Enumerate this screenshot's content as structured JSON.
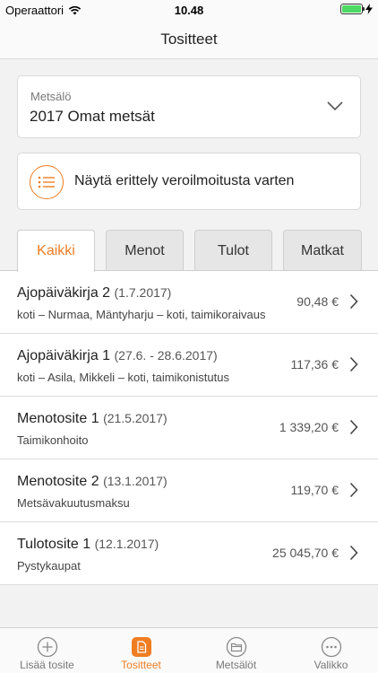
{
  "status": {
    "carrier": "Operaattori",
    "time": "10.48"
  },
  "nav": {
    "title": "Tositteet"
  },
  "forest_select": {
    "label": "Metsälö",
    "value": "2017 Omat metsät"
  },
  "breakdown": {
    "label": "Näytä erittely veroilmoitusta varten"
  },
  "tabs": [
    {
      "label": "Kaikki",
      "active": true
    },
    {
      "label": "Menot",
      "active": false
    },
    {
      "label": "Tulot",
      "active": false
    },
    {
      "label": "Matkat",
      "active": false
    }
  ],
  "entries": [
    {
      "title": "Ajopäiväkirja 2",
      "date": "(1.7.2017)",
      "subtitle": "koti – Nurmaa, Mäntyharju – koti, taimikoraivaus",
      "amount": "90,48 €"
    },
    {
      "title": "Ajopäiväkirja 1",
      "date": "(27.6. - 28.6.2017)",
      "subtitle": "koti – Asila, Mikkeli – koti, taimikonistutus",
      "amount": "117,36 €"
    },
    {
      "title": "Menotosite 1",
      "date": "(21.5.2017)",
      "subtitle": "Taimikonhoito",
      "amount": "1 339,20 €"
    },
    {
      "title": "Menotosite 2",
      "date": "(13.1.2017)",
      "subtitle": "Metsävakuutusmaksu",
      "amount": "119,70 €"
    },
    {
      "title": "Tulotosite 1",
      "date": "(12.1.2017)",
      "subtitle": "Pystykaupat",
      "amount": "25 045,70 €"
    }
  ],
  "tabbar": [
    {
      "label": "Lisää tosite",
      "icon": "plus-circle-icon",
      "active": false
    },
    {
      "label": "Tositteet",
      "icon": "document-icon",
      "active": true
    },
    {
      "label": "Metsälöt",
      "icon": "folder-icon",
      "active": false
    },
    {
      "label": "Valikko",
      "icon": "more-icon",
      "active": false
    }
  ],
  "colors": {
    "accent": "#ef7d22",
    "battery": "#4cd964"
  }
}
